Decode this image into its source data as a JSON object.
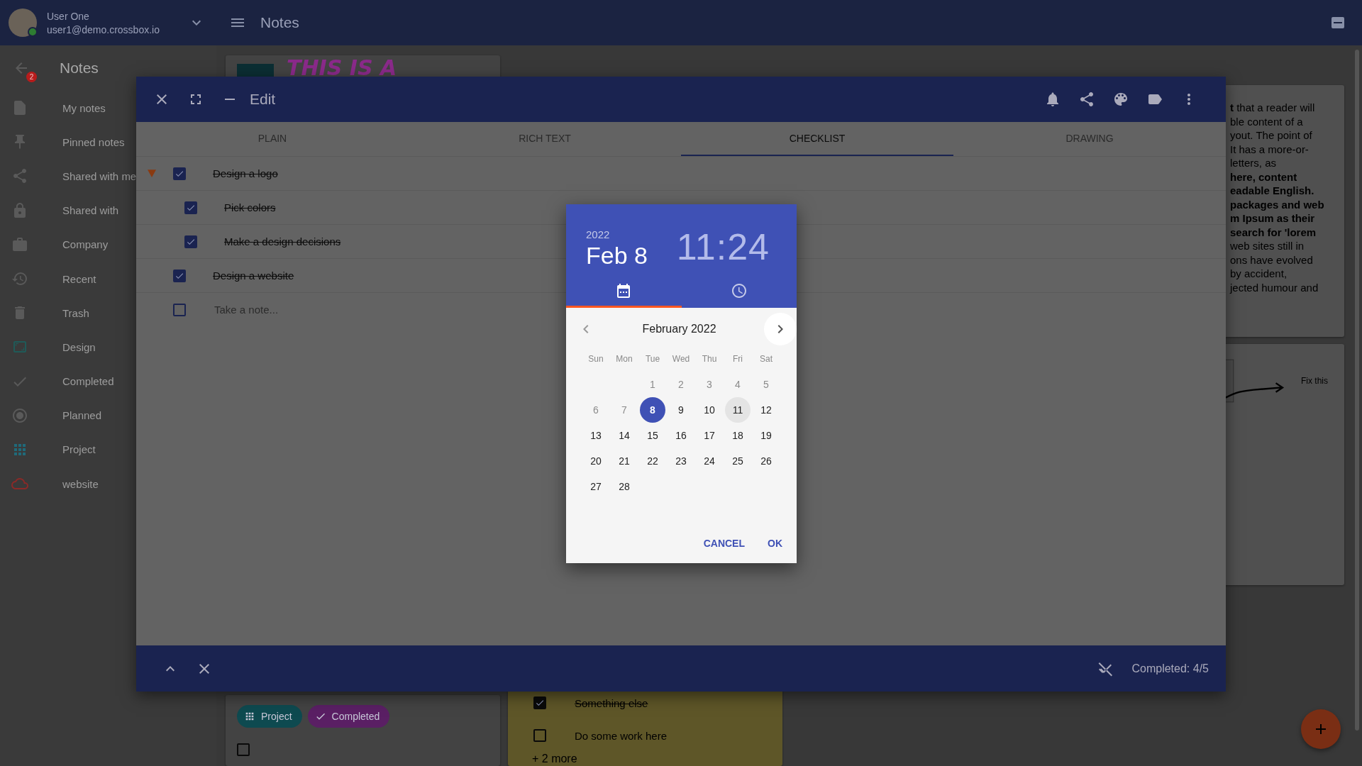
{
  "user": {
    "name": "User One",
    "email": "user1@demo.crossbox.io",
    "online": true
  },
  "header": {
    "title": "Notes"
  },
  "sidebar": {
    "title": "Notes",
    "badge": "2",
    "items": [
      {
        "label": "My notes"
      },
      {
        "label": "Pinned notes"
      },
      {
        "label": "Shared with me"
      },
      {
        "label": "Shared with"
      },
      {
        "label": "Company"
      },
      {
        "label": "Recent"
      },
      {
        "label": "Trash"
      },
      {
        "label": "Design",
        "color": "#1f5a58"
      },
      {
        "label": "Completed"
      },
      {
        "label": "Planned"
      },
      {
        "label": "Project",
        "color": "#1f6a7a"
      },
      {
        "label": "website",
        "color": "#8a2a28"
      }
    ]
  },
  "notes": {
    "drawing_note": {
      "text": "THIS IS A"
    },
    "tag_note": {
      "chips": [
        {
          "label": "Project",
          "color": "#0e4a50"
        },
        {
          "label": "Completed",
          "color": "#5a1f64"
        }
      ],
      "checked": false
    },
    "checklist_note": {
      "items": [
        {
          "text": "Something else",
          "checked": true
        },
        {
          "text": "Do some work here",
          "checked": false
        }
      ],
      "more": "+ 2 more"
    },
    "text_note": {
      "lines": [
        {
          "text": "**t** that a reader will",
          "bold": false
        },
        {
          "text": "ble content of a",
          "bold": false
        },
        {
          "text": "yout. The point of",
          "bold": false
        },
        {
          "text": "It has a more-or-",
          "bold": false
        },
        {
          "text": "letters, as",
          "bold": false
        },
        {
          "text": "here, content",
          "bold": true
        },
        {
          "text": "eadable English.",
          "bold": true
        },
        {
          "text": "packages and web",
          "bold": true
        },
        {
          "text": "m Ipsum as their",
          "bold": true
        },
        {
          "text": "search for 'lorem",
          "bold": true
        },
        {
          "text": "web sites still in",
          "bold": false
        },
        {
          "text": "ons have evolved",
          "bold": false
        },
        {
          "text": "by accident,",
          "bold": false
        },
        {
          "text": "jected humour and",
          "bold": false
        }
      ]
    },
    "sketch_note": {
      "caption": "Fix this"
    }
  },
  "edit": {
    "title": "Edit",
    "tabs": [
      {
        "label": "PLAIN",
        "selected": false
      },
      {
        "label": "RICH TEXT",
        "selected": false
      },
      {
        "label": "CHECKLIST",
        "selected": true
      },
      {
        "label": "DRAWING",
        "selected": false
      }
    ],
    "items": [
      {
        "text": "Design a logo",
        "checked": true,
        "expanded": true,
        "children": [
          {
            "text": "Pick colors",
            "checked": true
          },
          {
            "text": "Make a design decisions",
            "checked": true
          }
        ]
      },
      {
        "text": "Design a website",
        "checked": true
      }
    ],
    "new_item": {
      "placeholder": "Take a note...",
      "checked": false
    },
    "status": "Completed: 4/5"
  },
  "picker": {
    "year": "2022",
    "date": "Feb 8",
    "time": "11:24",
    "tabs": [
      {
        "kind": "calendar",
        "selected": true
      },
      {
        "kind": "clock",
        "selected": false
      }
    ],
    "month": "February 2022",
    "weekdays": [
      "Sun",
      "Mon",
      "Tue",
      "Wed",
      "Thu",
      "Fri",
      "Sat"
    ],
    "weeks": [
      [
        {
          "label": "1",
          "disabled": true,
          "selected": false,
          "highlighted": false
        },
        {
          "label": "2",
          "disabled": true,
          "selected": false,
          "highlighted": false
        },
        {
          "label": "3",
          "disabled": true,
          "selected": false,
          "highlighted": false
        },
        {
          "label": "4",
          "disabled": true,
          "selected": false,
          "highlighted": false
        },
        {
          "label": "5",
          "disabled": true,
          "selected": false,
          "highlighted": false
        }
      ],
      [
        {
          "label": "6",
          "disabled": true,
          "selected": false,
          "highlighted": false
        },
        {
          "label": "7",
          "disabled": true,
          "selected": false,
          "highlighted": false
        },
        {
          "label": "8",
          "disabled": false,
          "selected": true,
          "highlighted": false
        },
        {
          "label": "9",
          "disabled": false,
          "selected": false,
          "highlighted": false
        },
        {
          "label": "10",
          "disabled": false,
          "selected": false,
          "highlighted": false
        },
        {
          "label": "11",
          "disabled": false,
          "selected": false,
          "highlighted": true
        },
        {
          "label": "12",
          "disabled": false,
          "selected": false,
          "highlighted": false
        }
      ],
      [
        {
          "label": "13",
          "disabled": false,
          "selected": false,
          "highlighted": false
        },
        {
          "label": "14",
          "disabled": false,
          "selected": false,
          "highlighted": false
        },
        {
          "label": "15",
          "disabled": false,
          "selected": false,
          "highlighted": false
        },
        {
          "label": "16",
          "disabled": false,
          "selected": false,
          "highlighted": false
        },
        {
          "label": "17",
          "disabled": false,
          "selected": false,
          "highlighted": false
        },
        {
          "label": "18",
          "disabled": false,
          "selected": false,
          "highlighted": false
        },
        {
          "label": "19",
          "disabled": false,
          "selected": false,
          "highlighted": false
        }
      ],
      [
        {
          "label": "20",
          "disabled": false,
          "selected": false,
          "highlighted": false
        },
        {
          "label": "21",
          "disabled": false,
          "selected": false,
          "highlighted": false
        },
        {
          "label": "22",
          "disabled": false,
          "selected": false,
          "highlighted": false
        },
        {
          "label": "23",
          "disabled": false,
          "selected": false,
          "highlighted": false
        },
        {
          "label": "24",
          "disabled": false,
          "selected": false,
          "highlighted": false
        },
        {
          "label": "25",
          "disabled": false,
          "selected": false,
          "highlighted": false
        },
        {
          "label": "26",
          "disabled": false,
          "selected": false,
          "highlighted": false
        }
      ],
      [
        {
          "label": "27",
          "disabled": false,
          "selected": false,
          "highlighted": false
        },
        {
          "label": "28",
          "disabled": false,
          "selected": false,
          "highlighted": false
        }
      ]
    ],
    "buttons": [
      "CANCEL",
      "OK"
    ]
  }
}
